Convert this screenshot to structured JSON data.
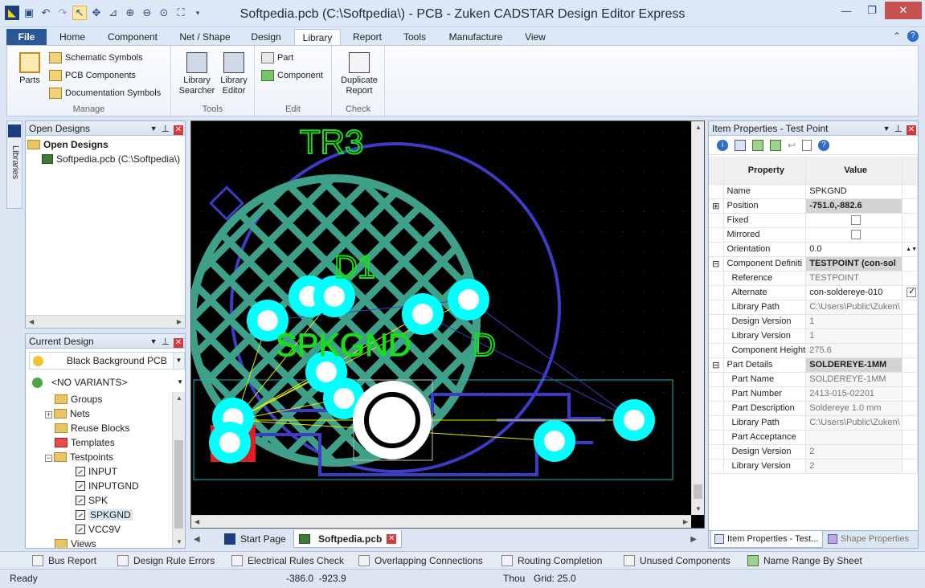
{
  "window": {
    "title": "Softpedia.pcb (C:\\Softpedia\\) - PCB - Zuken CADSTAR Design Editor Express"
  },
  "ribbon_tabs": [
    "File",
    "Home",
    "Component",
    "Net / Shape",
    "Design",
    "Library",
    "Report",
    "Tools",
    "Manufacture",
    "View"
  ],
  "ribbon": {
    "manage": {
      "label": "Manage",
      "parts": "Parts",
      "schematic_symbols": "Schematic Symbols",
      "pcb_components": "PCB Components",
      "documentation_symbols": "Documentation Symbols"
    },
    "tools": {
      "label": "Tools",
      "library_searcher": "Library Searcher",
      "library_editor": "Library Editor"
    },
    "edit": {
      "label": "Edit",
      "part": "Part",
      "component": "Component"
    },
    "check": {
      "label": "Check",
      "duplicate_report": "Duplicate Report"
    }
  },
  "libraries_strip": "Libraries",
  "open_designs": {
    "title": "Open Designs",
    "root": "Open Designs",
    "file": "Softpedia.pcb (C:\\Softpedia\\)"
  },
  "current_design": {
    "title": "Current Design",
    "background": "Black Background PCB",
    "variants": "<NO VARIANTS>",
    "tree": {
      "groups": "Groups",
      "nets": "Nets",
      "reuse_blocks": "Reuse Blocks",
      "templates": "Templates",
      "testpoints": "Testpoints",
      "tp_items": [
        "INPUT",
        "INPUTGND",
        "SPK",
        "SPKGND",
        "VCC9V"
      ],
      "views": "Views"
    }
  },
  "canvas": {
    "labels": {
      "trb": "TR3",
      "d1": "D1",
      "spkgnd": "SPKGND",
      "ovl": "D"
    },
    "colors": {
      "background": "#000000",
      "copper_hatch": "#3fa08a",
      "outline": "#3c3cc8",
      "pads": "#00ffff",
      "silk": "#18e018",
      "ratsnest": "#e8e800",
      "board_edge": "#19b4b4"
    }
  },
  "doc_tabs": {
    "start_page": "Start Page",
    "softpedia": "Softpedia.pcb"
  },
  "item_properties": {
    "title": "Item Properties - Test Point",
    "col_property": "Property",
    "col_value": "Value",
    "rows": [
      {
        "name": "Name",
        "value": "SPKGND"
      },
      {
        "name": "Position",
        "value": "-751.0,-882.6"
      },
      {
        "name": "Fixed",
        "value": ""
      },
      {
        "name": "Mirrored",
        "value": ""
      },
      {
        "name": "Orientation",
        "value": "0.0"
      },
      {
        "name": "Component Definiti",
        "value": "TESTPOINT (con-sol"
      },
      {
        "name": "Reference",
        "value": "TESTPOINT"
      },
      {
        "name": "Alternate",
        "value": "con-soldereye-010"
      },
      {
        "name": "Library Path",
        "value": "C:\\Users\\Public\\Zuken\\"
      },
      {
        "name": "Design Version",
        "value": "1"
      },
      {
        "name": "Library Version",
        "value": "1"
      },
      {
        "name": "Component Height",
        "value": "275.6"
      },
      {
        "name": "Part Details",
        "value": "SOLDEREYE-1MM"
      },
      {
        "name": "Part Name",
        "value": "SOLDEREYE-1MM"
      },
      {
        "name": "Part Number",
        "value": "2413-015-02201"
      },
      {
        "name": "Part Description",
        "value": "Soldereye 1.0 mm"
      },
      {
        "name": "Library Path",
        "value": "C:\\Users\\Public\\Zuken\\"
      },
      {
        "name": "Part Acceptance",
        "value": ""
      },
      {
        "name": "Design Version",
        "value": "2"
      },
      {
        "name": "Library Version",
        "value": "2"
      }
    ],
    "tab_item": "Item Properties - Test...",
    "tab_shape": "Shape Properties"
  },
  "bottom_tabs": [
    "Bus Report",
    "Design Rule Errors",
    "Electrical Rules Check",
    "Overlapping Connections",
    "Routing Completion",
    "Unused Components",
    "Name Range By Sheet"
  ],
  "status": {
    "ready": "Ready",
    "coords": "-386.0  -923.9",
    "units": "Thou",
    "grid": "Grid: 25.0"
  }
}
